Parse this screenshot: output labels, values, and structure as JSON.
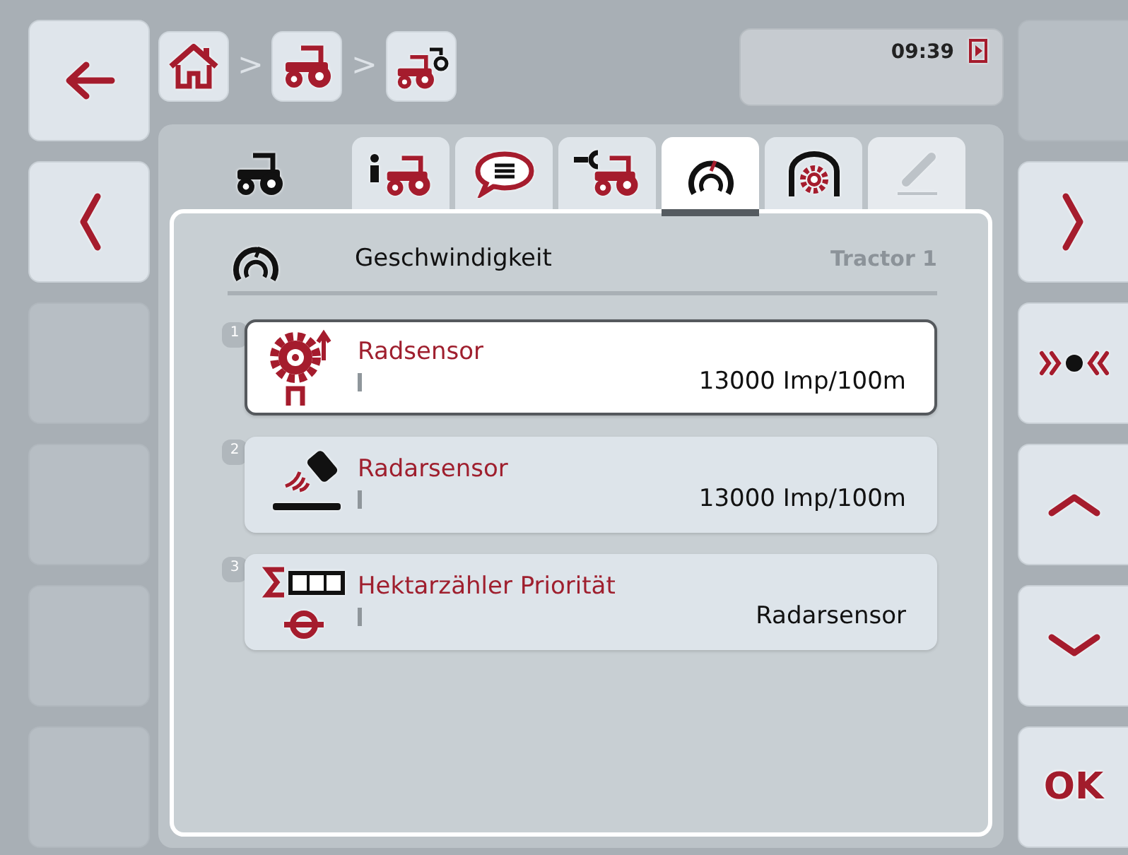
{
  "left_buttons": [
    {
      "kind": "back"
    },
    {
      "kind": "previous"
    },
    {
      "kind": "empty"
    },
    {
      "kind": "empty"
    },
    {
      "kind": "empty"
    },
    {
      "kind": "empty"
    }
  ],
  "breadcrumb": [
    {
      "kind": "home"
    },
    {
      "kind": "tractor",
      "separator": ">"
    },
    {
      "kind": "tractor-settings",
      "separator": ">"
    }
  ],
  "status": {
    "time": "09:39"
  },
  "tabs": [
    {
      "kind": "info",
      "selected": false,
      "disabled": false
    },
    {
      "kind": "messages",
      "selected": false,
      "disabled": false
    },
    {
      "kind": "service",
      "selected": false,
      "disabled": false
    },
    {
      "kind": "speed",
      "selected": true,
      "disabled": false
    },
    {
      "kind": "pto",
      "selected": false,
      "disabled": false
    },
    {
      "kind": "edit",
      "selected": false,
      "disabled": true
    }
  ],
  "panel": {
    "title": "Geschwindigkeit",
    "subtitle": "Tractor 1"
  },
  "settings": [
    {
      "number": "1",
      "kind": "wheel-sensor",
      "label": "Radsensor",
      "value": "13000 Imp/100m",
      "selected": true
    },
    {
      "number": "2",
      "kind": "radar-sensor",
      "label": "Radarsensor",
      "value": "13000 Imp/100m",
      "selected": false
    },
    {
      "number": "3",
      "kind": "hectare-counter",
      "label": "Hektarzähler Priorität",
      "value": "Radarsensor",
      "selected": false
    }
  ],
  "right_buttons": [
    {
      "kind": "empty"
    },
    {
      "kind": "next"
    },
    {
      "kind": "select"
    },
    {
      "kind": "up"
    },
    {
      "kind": "down"
    },
    {
      "kind": "ok",
      "label": "OK"
    }
  ]
}
